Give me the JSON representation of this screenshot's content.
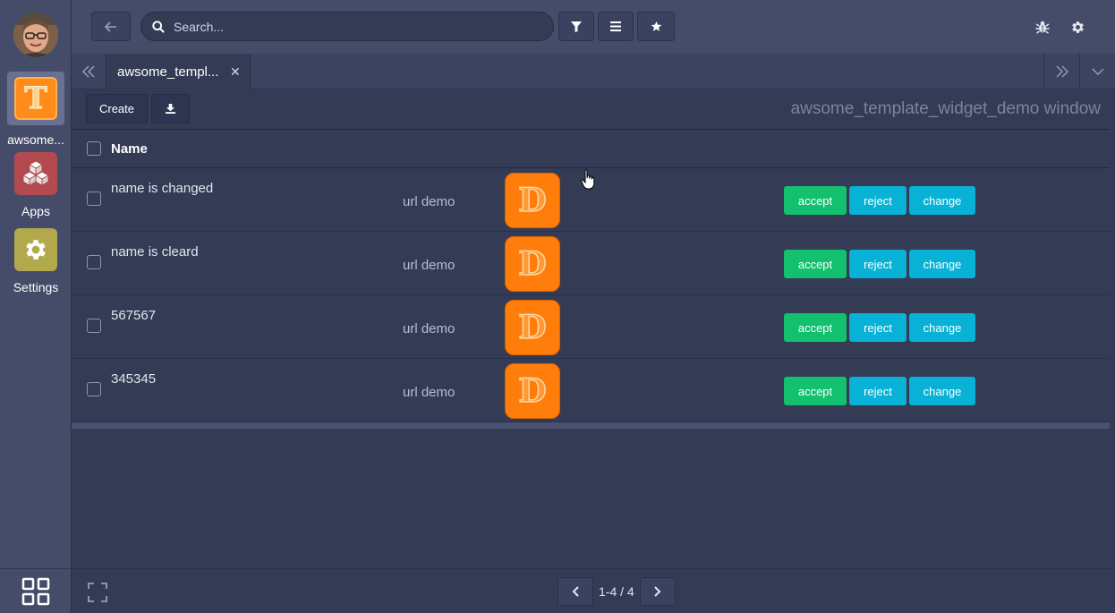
{
  "colors": {
    "background": "#343b55",
    "sidebar": "#454c69",
    "accept": "#12c06e",
    "info": "#07b2d6",
    "brand_orange": "#ff7d0a"
  },
  "sidebar": {
    "apps": [
      {
        "label": "awsome...",
        "icon": "T",
        "active": true
      },
      {
        "label": "Apps",
        "icon": "cubes-icon",
        "active": false
      },
      {
        "label": "Settings",
        "icon": "gear-icon",
        "active": false
      }
    ]
  },
  "topbar": {
    "search_placeholder": "Search...",
    "icons": [
      "back-arrow-icon",
      "search-icon",
      "filter-icon",
      "list-icon",
      "star-icon",
      "bug-icon",
      "gear-icon"
    ]
  },
  "tabs": [
    {
      "label": "awsome_templ...",
      "active": true
    }
  ],
  "controls": {
    "create_label": "Create",
    "window_title": "awsome_template_widget_demo window"
  },
  "list": {
    "header_name": "Name",
    "rows": [
      {
        "name": "name is changed",
        "url": "url demo",
        "logo_letter": "D",
        "actions": [
          "accept",
          "reject",
          "change"
        ]
      },
      {
        "name": "name is cleard",
        "url": "url demo",
        "logo_letter": "D",
        "actions": [
          "accept",
          "reject",
          "change"
        ]
      },
      {
        "name": "567567",
        "url": "url demo",
        "logo_letter": "D",
        "actions": [
          "accept",
          "reject",
          "change"
        ]
      },
      {
        "name": "345345",
        "url": "url demo",
        "logo_letter": "D",
        "actions": [
          "accept",
          "reject",
          "change"
        ]
      }
    ]
  },
  "pager": {
    "text": "1-4 / 4"
  }
}
